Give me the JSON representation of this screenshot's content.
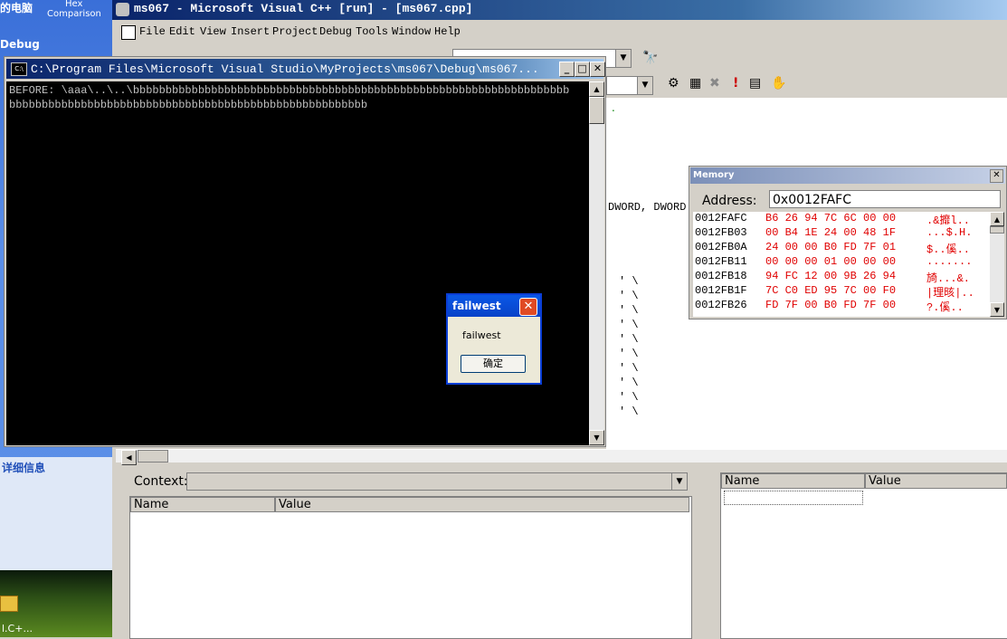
{
  "desktop": {
    "top_left_label": "的电脑",
    "hex_label_1": "Hex",
    "hex_label_2": "Comparison",
    "debug_label": "Debug",
    "detail_label": "详细信息",
    "shortcut_label": "l.C+..."
  },
  "vc_window": {
    "title": "ms067 - Microsoft Visual C++ [run] - [ms067.cpp]",
    "menu": [
      "File",
      "Edit",
      "View",
      "Insert",
      "Project",
      "Debug",
      "Tools",
      "Window",
      "Help"
    ],
    "editor_line": "DWORD, DWORD"
  },
  "console": {
    "title": "C:\\Program Files\\Microsoft Visual Studio\\MyProjects\\ms067\\Debug\\ms067...",
    "line1": "BEFORE: \\aaa\\..\\..\\bbbbbbbbbbbbbbbbbbbbbbbbbbbbbbbbbbbbbbbbbbbbbbbbbbbbbbbbbbbbbbbbbbb",
    "line2": "bbbbbbbbbbbbbbbbbbbbbbbbbbbbbbbbbbbbbbbbbbbbbbbbbbbbbbb"
  },
  "memory": {
    "title": "Memory",
    "address_label": "Address:",
    "address_value": "0x0012FAFC",
    "rows": [
      {
        "addr": "0012FAFC",
        "hex": "B6 26 94 7C 6C 00 00",
        "chars": ".&攠l.."
      },
      {
        "addr": "0012FB03",
        "hex": "00 B4 1E 24 00 48 1F",
        "chars": "...$.H."
      },
      {
        "addr": "0012FB0A",
        "hex": "24 00 00 B0 FD 7F 01",
        "chars": "$..傒.."
      },
      {
        "addr": "0012FB11",
        "hex": "00 00 00 01 00 00 00",
        "chars": "......."
      },
      {
        "addr": "0012FB18",
        "hex": "94 FC 12 00 9B 26 94",
        "chars": "旑...&."
      },
      {
        "addr": "0012FB1F",
        "hex": "7C C0 ED 95 7C 00 F0",
        "chars": "|理晐|.."
      },
      {
        "addr": "0012FB26",
        "hex": "FD 7F 00 B0 FD 7F 00",
        "chars": "?.傒.."
      }
    ]
  },
  "msgbox": {
    "title": "failwest",
    "text": "failwest",
    "ok_label": "确定"
  },
  "locals": {
    "context_label": "Context:",
    "name_header": "Name",
    "value_header": "Value"
  },
  "watch": {
    "name_header": "Name",
    "value_header": "Value"
  }
}
